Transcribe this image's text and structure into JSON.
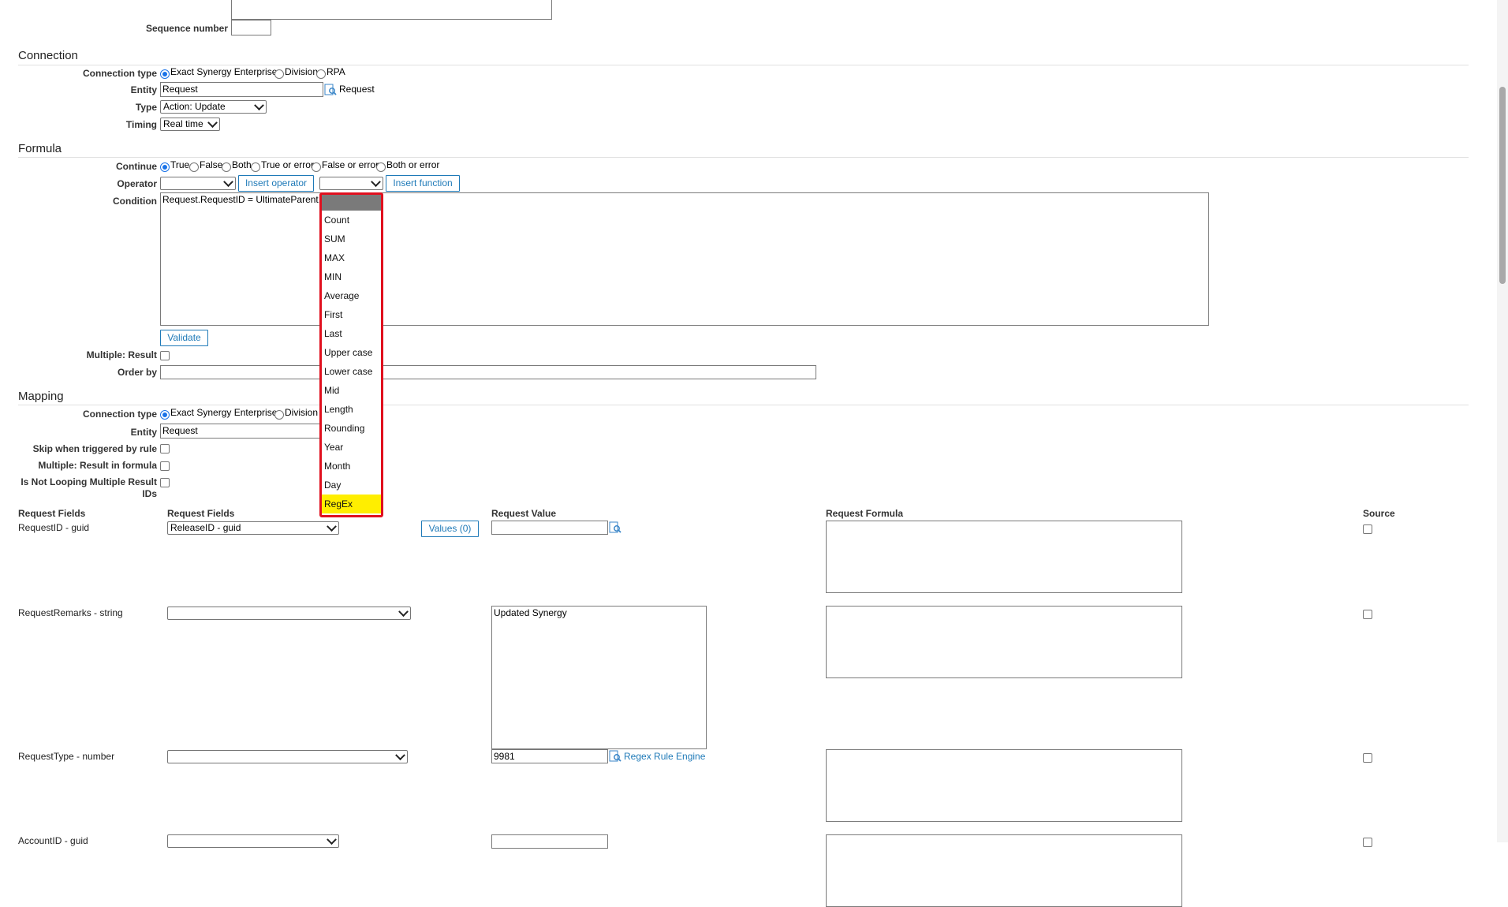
{
  "top": {
    "sequence_label": "Sequence number",
    "sequence_value": ""
  },
  "connection": {
    "title": "Connection",
    "type_label": "Connection type",
    "type_options": [
      "Exact Synergy Enterprise",
      "Division",
      "RPA"
    ],
    "entity_label": "Entity",
    "entity_value": "Request",
    "entity_lookup_text": "Request",
    "kind_label": "Type",
    "kind_value": "Action: Update",
    "timing_label": "Timing",
    "timing_value": "Real time"
  },
  "formula": {
    "title": "Formula",
    "continue_label": "Continue",
    "continue_options": [
      "True",
      "False",
      "Both",
      "True or error",
      "False or error",
      "Both or error"
    ],
    "operator_label": "Operator",
    "insert_operator": "Insert operator",
    "insert_function": "Insert function",
    "condition_label": "Condition",
    "condition_value": "Request.RequestID = UltimateParent.R",
    "validate": "Validate",
    "multiple_result_label": "Multiple: Result",
    "order_by_label": "Order by",
    "functions": [
      "",
      "Count",
      "SUM",
      "MAX",
      "MIN",
      "Average",
      "First",
      "Last",
      "Upper case",
      "Lower case",
      "Mid",
      "Length",
      "Rounding",
      "Year",
      "Month",
      "Day",
      "RegEx"
    ],
    "highlighted_function": "RegEx"
  },
  "mapping": {
    "title": "Mapping",
    "type_label": "Connection type",
    "type_options": [
      "Exact Synergy Enterprise",
      "Division"
    ],
    "entity_label": "Entity",
    "entity_value": "Request",
    "skip_label": "Skip when triggered by rule",
    "multiple_label": "Multiple: Result in formula",
    "not_looping_label": "Is Not Looping Multiple Result IDs"
  },
  "fields_table": {
    "headers": [
      "Request Fields",
      "Request Fields",
      "Request Value",
      "Request Formula",
      "Source"
    ],
    "rows": [
      {
        "name": "RequestID - guid",
        "field": "ReleaseID - guid",
        "values_button": "Values (0)",
        "value": ""
      },
      {
        "name": "RequestRemarks - string",
        "field": "",
        "value": "Updated Synergy"
      },
      {
        "name": "RequestType - number",
        "field": "",
        "value": "9981",
        "link": "Regex Rule Engine"
      },
      {
        "name": "AccountID - guid",
        "field": "",
        "value": ""
      }
    ]
  }
}
